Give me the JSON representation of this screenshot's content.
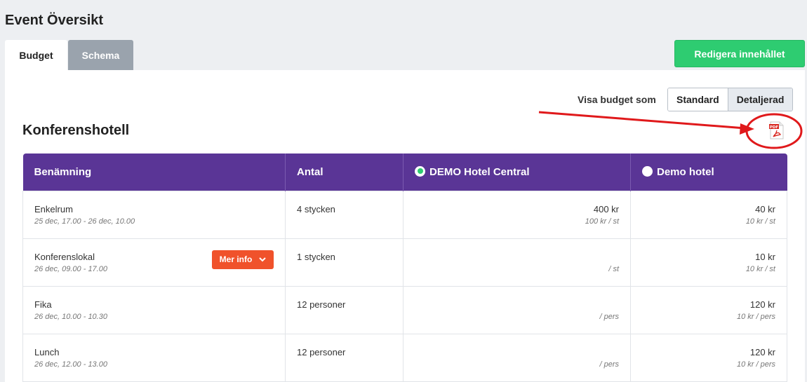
{
  "page": {
    "title": "Event Översikt"
  },
  "tabs": [
    {
      "label": "Budget",
      "active": true
    },
    {
      "label": "Schema",
      "active": false
    }
  ],
  "edit_button": "Redigera innehållet",
  "view_toggle": {
    "label": "Visa budget som",
    "options": [
      "Standard",
      "Detaljerad"
    ],
    "selected": "Detaljerad"
  },
  "section": {
    "title": "Konferenshotell",
    "pdf_icon": "pdf-icon"
  },
  "table": {
    "headers": {
      "name": "Benämning",
      "qty": "Antal",
      "hotel1": "DEMO Hotel Central",
      "hotel2": "Demo hotel"
    },
    "rows": [
      {
        "name": "Enkelrum",
        "time": "25 dec, 17.00 - 26 dec, 10.00",
        "qty": "4 stycken",
        "h1_price": "400 kr",
        "h1_unit": "100 kr / st",
        "h2_price": "40 kr",
        "h2_unit": "10 kr / st"
      },
      {
        "name": "Konferenslokal",
        "time": "26 dec, 09.00 - 17.00",
        "qty": "1 stycken",
        "h1_price": "",
        "h1_unit": "/ st",
        "h2_price": "10 kr",
        "h2_unit": "10 kr / st",
        "more": "Mer info"
      },
      {
        "name": "Fika",
        "time": "26 dec, 10.00 - 10.30",
        "qty": "12 personer",
        "h1_price": "",
        "h1_unit": "/ pers",
        "h2_price": "120 kr",
        "h2_unit": "10 kr / pers"
      },
      {
        "name": "Lunch",
        "time": "26 dec, 12.00 - 13.00",
        "qty": "12 personer",
        "h1_price": "",
        "h1_unit": "/ pers",
        "h2_price": "120 kr",
        "h2_unit": "10 kr / pers"
      }
    ]
  },
  "colors": {
    "header_purple": "#5a3596",
    "green": "#2ecc71",
    "orange": "#f0522b",
    "annotation_red": "#e0191b"
  }
}
